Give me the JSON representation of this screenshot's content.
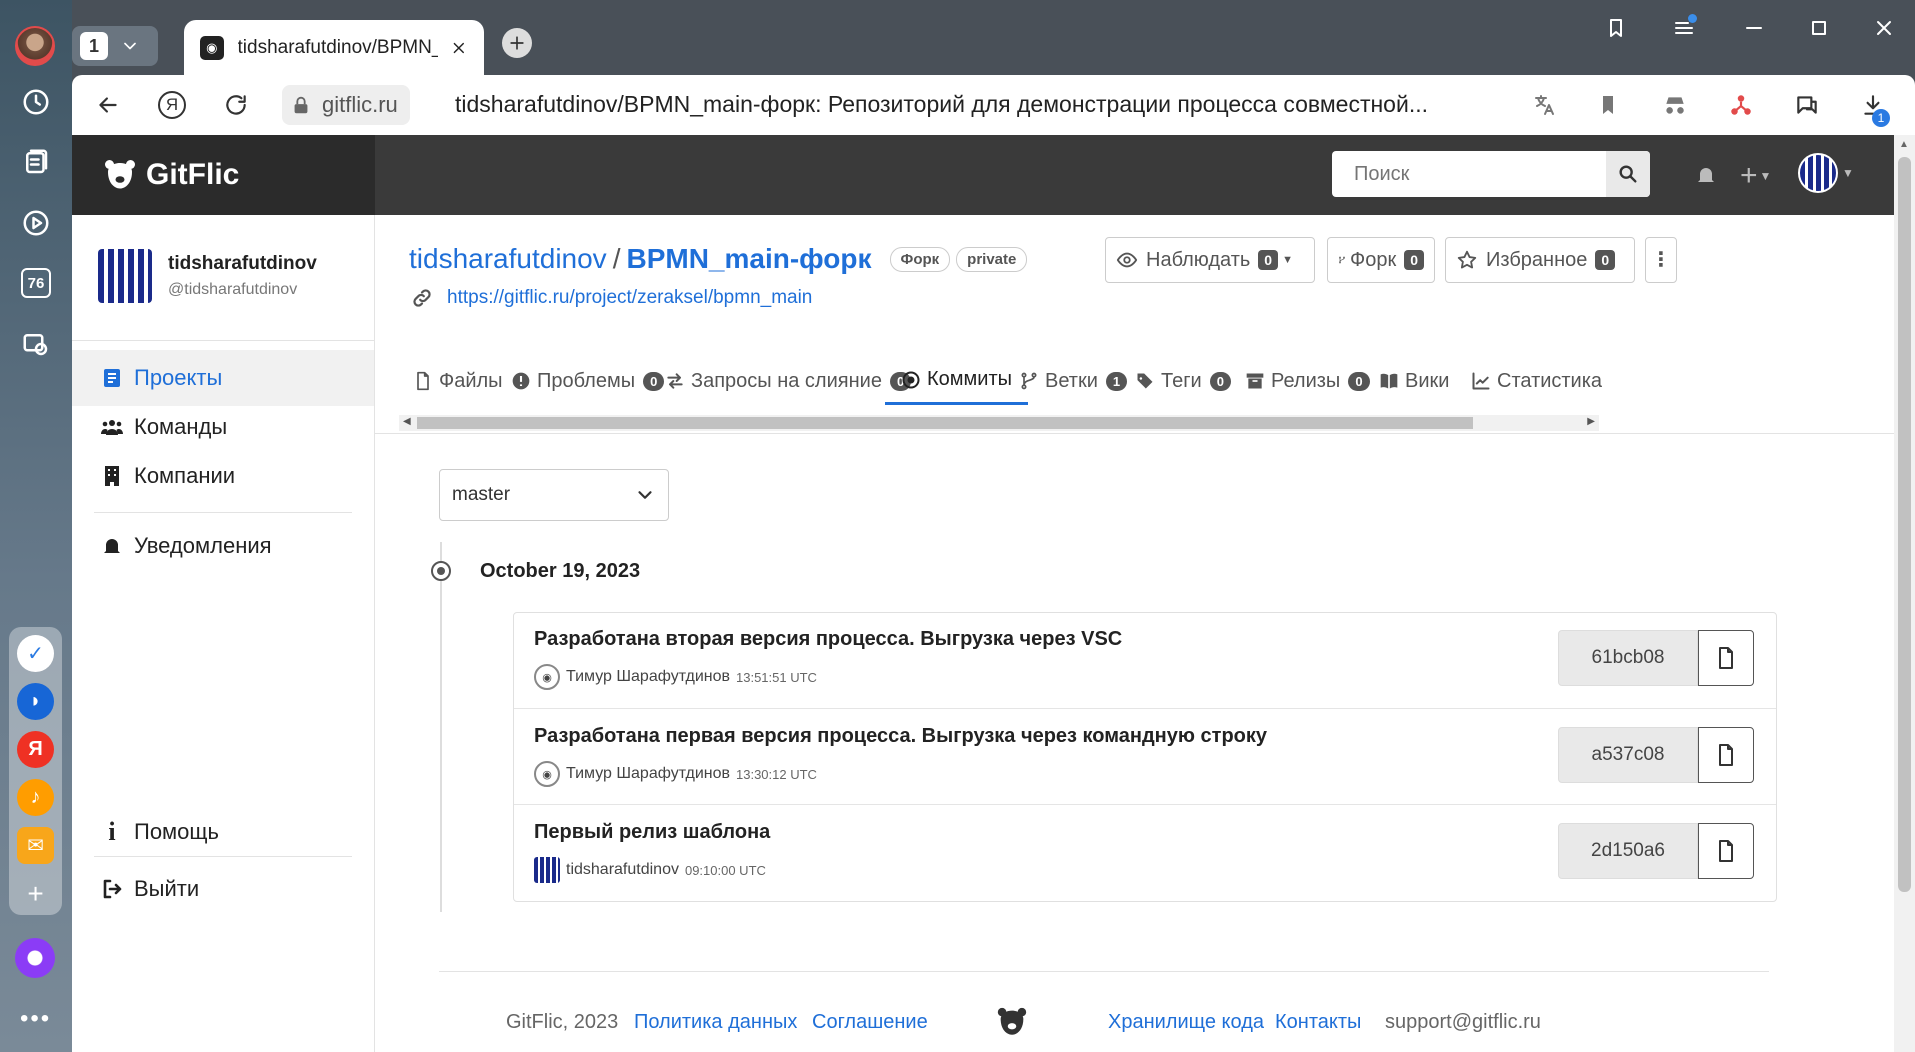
{
  "os_sidebar": {
    "badge_number": "76",
    "dock_apps": [
      "tasks",
      "browser-lite",
      "yandex",
      "music",
      "mail"
    ]
  },
  "tabbar": {
    "tab_count": "1",
    "active_tab_title": "tidsharafutdinov/BPMN_main-форк"
  },
  "address": {
    "domain": "gitflic.ru",
    "page_title": "tidsharafutdinov/BPMN_main-форк: Репозиторий для демонстрации процесса совместной...",
    "downloads_badge": "1"
  },
  "header": {
    "logo_text": "GitFlic",
    "search_placeholder": "Поиск"
  },
  "sidebar": {
    "user_name": "tidsharafutdinov",
    "user_handle": "@tidsharafutdinov",
    "items": [
      {
        "label": "Проекты",
        "icon": "projects-icon"
      },
      {
        "label": "Команды",
        "icon": "teams-icon"
      },
      {
        "label": "Компании",
        "icon": "companies-icon"
      },
      {
        "label": "Уведомления",
        "icon": "bell-icon"
      }
    ],
    "help_label": "Помощь",
    "logout_label": "Выйти"
  },
  "repo": {
    "owner": "tidsharafutdinov",
    "separator": "/",
    "name": "BPMN_main-форк",
    "badge_fork": "Форк",
    "badge_private": "private",
    "fork_source_url": "https://gitflic.ru/project/zeraksel/bpmn_main",
    "watch_label": "Наблюдать",
    "watch_count": "0",
    "fork_label": "Форк",
    "fork_count": "0",
    "favorite_label": "Избранное",
    "favorite_count": "0"
  },
  "tabs": [
    {
      "label": "Файлы",
      "count": null
    },
    {
      "label": "Проблемы",
      "count": "0"
    },
    {
      "label": "Запросы на слияние",
      "count": "0"
    },
    {
      "label": "Коммиты",
      "count": null
    },
    {
      "label": "Ветки",
      "count": "1"
    },
    {
      "label": "Теги",
      "count": "0"
    },
    {
      "label": "Релизы",
      "count": "0"
    },
    {
      "label": "Вики",
      "count": null
    },
    {
      "label": "Статистика",
      "count": null
    }
  ],
  "commits_page": {
    "branch": "master",
    "date_heading": "October 19, 2023",
    "commits": [
      {
        "message": "Разработана вторая версия процесса. Выгрузка через VSC",
        "author": "Тимур Шарафутдинов",
        "time": "13:51:51 UTC",
        "sha": "61bcb08"
      },
      {
        "message": "Разработана первая версия процесса. Выгрузка через командную строку",
        "author": "Тимур Шарафутдинов",
        "time": "13:30:12 UTC",
        "sha": "a537c08"
      },
      {
        "message": "Первый релиз шаблона",
        "author": "tidsharafutdinov",
        "time": "09:10:00 UTC",
        "sha": "2d150a6"
      }
    ]
  },
  "footer": {
    "copyright": "GitFlic, 2023",
    "privacy": "Политика данных",
    "agreement": "Соглашение",
    "storage": "Хранилище кода",
    "contacts": "Контакты",
    "email": "support@gitflic.ru"
  },
  "colors": {
    "accent": "#1f6fd8",
    "header_bg": "#3a3a3a",
    "logo_bg": "#2b2b2b"
  }
}
